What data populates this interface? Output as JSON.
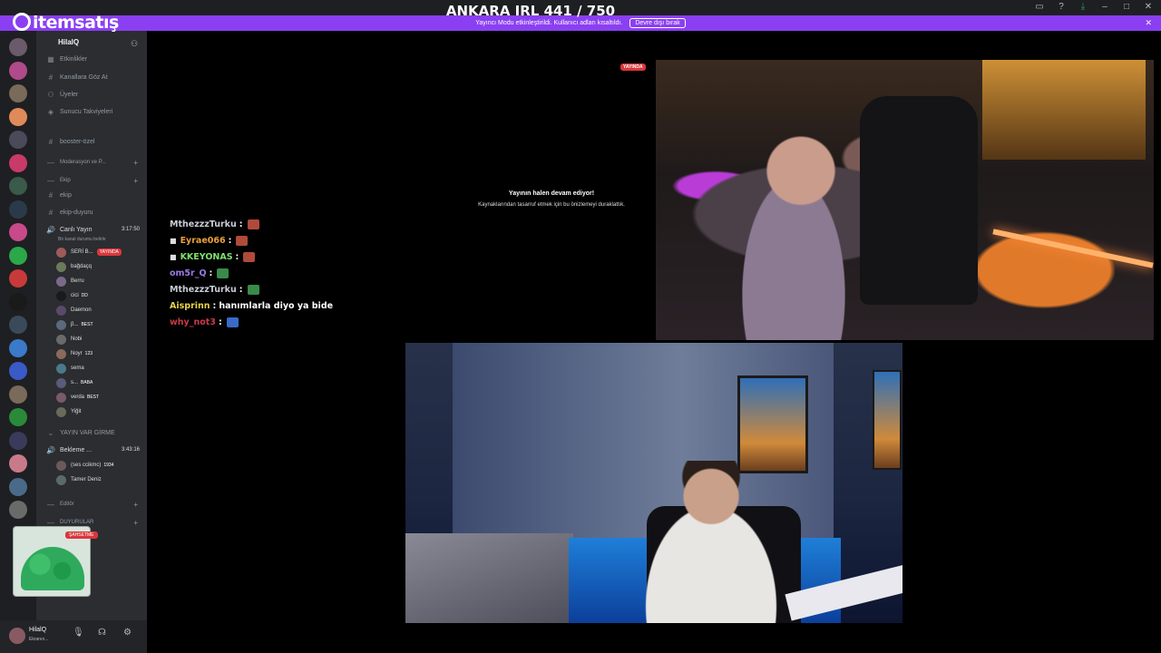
{
  "app": {
    "brand": "itemsatış",
    "overlay_title": "ANKARA IRL 441 / 750",
    "colors": {
      "accent": "#8b3ff2",
      "live": "#da373c",
      "sidebar": "#2b2d31",
      "rail": "#1e1f22"
    }
  },
  "banner": {
    "text": "Yayıncı Modu etkinleştirildi. Kullanıcı adları kısaltıldı.",
    "button": "Devre dışı bırak"
  },
  "guild": {
    "name": "HilalQ",
    "items": [
      "Etkinlikler",
      "Kanallara Göz At",
      "Üyeler",
      "Sunucu Takviyeleri"
    ]
  },
  "channels": {
    "booster": "booster-özel",
    "cat_mod": "Moderasyon ve P...",
    "cat_ekip": "Ekip",
    "ekip": "ekip",
    "ekip_duyuru": "ekip-duyuru",
    "live_voice": "Canlı Yayın",
    "live_timer": "3:17:50",
    "live_status": "Bir kanal durumu belirle",
    "cat_yayin": "YAYIN VAR GİRME",
    "waiting_voice": "Bekleme ...",
    "waiting_timer": "3:43:16",
    "cat_editor": "Editör",
    "cat_duyurular": "DUYURULAR"
  },
  "voice_users": [
    {
      "name": "SERİ B...",
      "live": "YAYINDA",
      "color": "#a05a5a"
    },
    {
      "name": "bağdaçq",
      "color": "#6a7a5a"
    },
    {
      "name": "Berru",
      "color": "#7a6a8a"
    },
    {
      "name": "cici",
      "tag": "DD",
      "color": "#1a1a1a"
    },
    {
      "name": "Daemon",
      "color": "#5a4a6a"
    },
    {
      "name": "β...",
      "tag": "BEST",
      "color": "#5a6a7a"
    },
    {
      "name": "Nobi",
      "color": "#6a6a6a"
    },
    {
      "name": "Noyr",
      "tag": "123",
      "color": "#8a6a5a"
    },
    {
      "name": "sema",
      "color": "#4a7a8a"
    },
    {
      "name": "s...",
      "tag": "BABA",
      "color": "#5a5a7a"
    },
    {
      "name": "verda",
      "tag": "BEST",
      "color": "#7a5a6a"
    },
    {
      "name": "Yiğit",
      "color": "#6a6a5a"
    }
  ],
  "waiting_users": [
    {
      "name": "(ses ccikmc)",
      "tag": "1934",
      "color": "#6a5a5a"
    },
    {
      "name": "Tamer Deniz",
      "color": "#5a6a6a"
    }
  ],
  "sticker": {
    "label": "ŞAHSETME"
  },
  "user": {
    "name": "HilalQ",
    "status": "Ekranın..."
  },
  "stream": {
    "live_badge": "YAYINDA",
    "paused_title": "Yayının halen devam ediyor!",
    "paused_sub": "Kaynaklarından tasarruf etmek için bu önizlemeyi duraklattık."
  },
  "chat": [
    {
      "user": "MthezzzTurku",
      "color": "#c8ccd6",
      "emote": "#b04a3a"
    },
    {
      "user": "Eyrae066",
      "color": "#e8a03a",
      "bullet": true,
      "emote": "#b04a3a"
    },
    {
      "user": "KKEYONAS",
      "color": "#7ee26a",
      "bullet": true,
      "emote": "#b04a3a"
    },
    {
      "user": "om5r_Q",
      "color": "#9a7ae8",
      "emote": "#3a8a4a"
    },
    {
      "user": "MthezzzTurku",
      "color": "#c8ccd6",
      "emote": "#3a8a4a"
    },
    {
      "user": "Aisprinn",
      "color": "#e8d24a",
      "message": "hanımlarla diyo ya bide"
    },
    {
      "user": "why_not3",
      "color": "#c83a4a",
      "emote": "#3a6ac8"
    }
  ]
}
